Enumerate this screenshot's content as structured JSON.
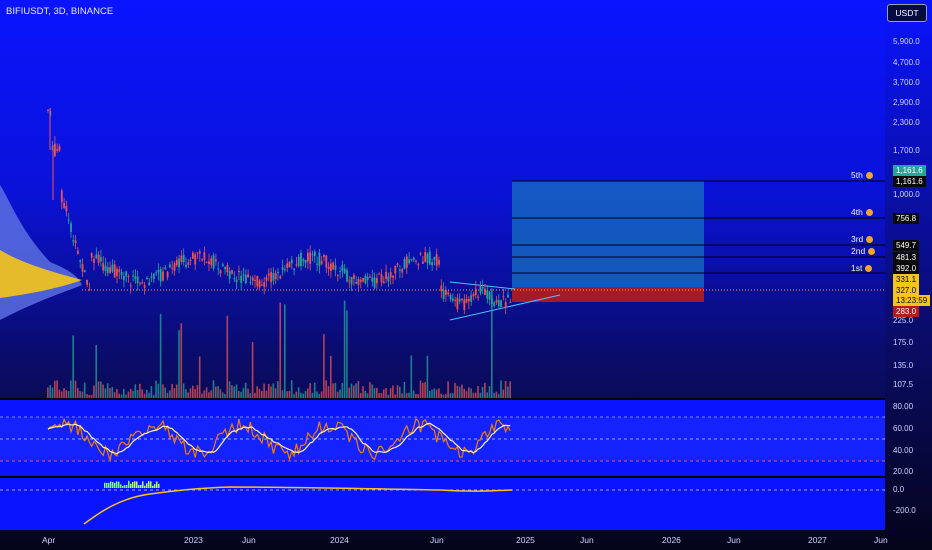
{
  "header": {
    "symbol": "BIFIUSDT, 3D, BINANCE",
    "currency_button": "USDT"
  },
  "price_axis": [
    "5,900.0",
    "4,700.0",
    "3,700.0",
    "2,900.0",
    "2,300.0",
    "1,700.0",
    "1,000.0",
    "225.0",
    "175.0",
    "135.0",
    "107.5"
  ],
  "price_tags": {
    "t1": "1,161.6",
    "t2": "1,161.6",
    "t3": "756.8",
    "t4": "549.7",
    "t5": "481.3",
    "t6": "392.0",
    "t7": "331.1",
    "t8": "327.0",
    "t9": "13:23:59",
    "t10": "283.0"
  },
  "fib_levels": [
    "5th",
    "4th",
    "3rd",
    "2nd",
    "1st"
  ],
  "rsi_axis": [
    "80.00",
    "60.00",
    "40.00",
    "20.00"
  ],
  "osc_axis": [
    "0.0",
    "-200.0"
  ],
  "time_axis": [
    "Apr",
    "2023",
    "Jun",
    "2024",
    "Jun",
    "2025",
    "Jun",
    "2026",
    "Jun",
    "2027",
    "Jun"
  ],
  "colors": {
    "up": "#26a69a",
    "down": "#ef5350",
    "accent": "#f5c518",
    "target": "#1565c0",
    "stop": "#b71c1c"
  }
}
